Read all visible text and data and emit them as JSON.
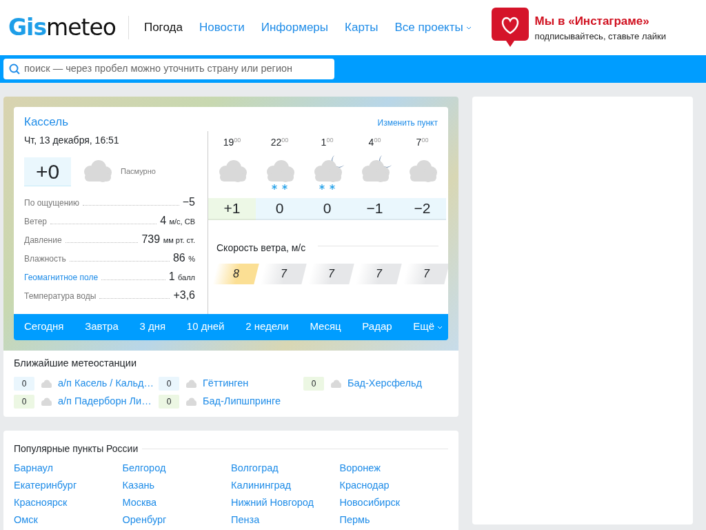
{
  "header": {
    "logo": {
      "accent": "Gis",
      "rest": "meteo"
    },
    "nav": [
      {
        "label": "Погода",
        "selected": true,
        "dropdown": false
      },
      {
        "label": "Новости",
        "selected": false,
        "dropdown": false
      },
      {
        "label": "Информеры",
        "selected": false,
        "dropdown": false
      },
      {
        "label": "Карты",
        "selected": false,
        "dropdown": false
      },
      {
        "label": "Все проекты",
        "selected": false,
        "dropdown": true
      }
    ],
    "promo": {
      "title": "Мы в «Инстаграме»",
      "subtitle": "подписывайтесь, ставьте лайки"
    }
  },
  "search": {
    "placeholder": "поиск — через пробел можно уточнить страну или регион"
  },
  "weather": {
    "city": "Кассель",
    "change_link": "Изменить пункт",
    "datetime": "Чт, 13 декабря, 16:51",
    "temperature": "+0",
    "condition": "Пасмурно",
    "details": [
      {
        "label": "По ощущению",
        "value": "−5",
        "kind": "text"
      },
      {
        "label": "Ветер",
        "value": "4",
        "unit": "м/с, СВ",
        "kind": "text"
      },
      {
        "label": "Давление",
        "value": "739",
        "unit": "мм рт. ст.",
        "kind": "text"
      },
      {
        "label": "Влажность",
        "value": "86",
        "unit": "%",
        "kind": "text"
      },
      {
        "label": "Геомагнитное поле",
        "value": "1",
        "unit": "балл",
        "kind": "link"
      },
      {
        "label": "Температура воды",
        "value": "+3,6",
        "kind": "text"
      }
    ],
    "hours": [
      {
        "hour": "19",
        "minutes": "00",
        "night": false,
        "snow": false,
        "temp": "+1",
        "color": "#edf8e6",
        "wind": "8",
        "gust": true
      },
      {
        "hour": "22",
        "minutes": "00",
        "night": false,
        "snow": true,
        "temp": "0",
        "color": "#eaf7fd",
        "wind": "7",
        "gust": false
      },
      {
        "hour": "1",
        "minutes": "00",
        "night": true,
        "snow": true,
        "temp": "0",
        "color": "#eaf7fd",
        "wind": "7",
        "gust": false
      },
      {
        "hour": "4",
        "minutes": "00",
        "night": true,
        "snow": false,
        "temp": "−1",
        "color": "#eaf7fd",
        "wind": "7",
        "gust": false
      },
      {
        "hour": "7",
        "minutes": "00",
        "night": false,
        "snow": false,
        "temp": "−2",
        "color": "#eaf7fd",
        "wind": "7",
        "gust": false
      }
    ],
    "wind_title": "Скорость ветра, м/с",
    "tabs": [
      {
        "label": "Сегодня",
        "dropdown": false
      },
      {
        "label": "Завтра",
        "dropdown": false
      },
      {
        "label": "3 дня",
        "dropdown": false
      },
      {
        "label": "10 дней",
        "dropdown": false
      },
      {
        "label": "2 недели",
        "dropdown": false
      },
      {
        "label": "Месяц",
        "dropdown": false
      },
      {
        "label": "Радар",
        "dropdown": false
      },
      {
        "label": "Ещё",
        "dropdown": true
      }
    ]
  },
  "stations": {
    "title": "Ближайшие метеостанции",
    "items": [
      {
        "temp": "0",
        "color": "#eaf6fd",
        "name": "а/п Касель / Кальд…"
      },
      {
        "temp": "0",
        "color": "#eaf6fd",
        "name": "Гёттинген"
      },
      {
        "temp": "0",
        "color": "#ecf7e3",
        "name": "Бад-Херсфельд"
      },
      {
        "temp": "0",
        "color": "#ecf7e3",
        "name": "а/п Падерборн Ли…"
      },
      {
        "temp": "0",
        "color": "#ecf7e3",
        "name": "Бад-Липшпринге"
      }
    ]
  },
  "popular": {
    "title": "Популярные пункты России",
    "cities": [
      "Барнаул",
      "Белгород",
      "Волгоград",
      "Воронеж",
      "Екатеринбург",
      "Казань",
      "Калининград",
      "Краснодар",
      "Красноярск",
      "Москва",
      "Нижний Новгород",
      "Новосибирск",
      "Омск",
      "Оренбург",
      "Пенза",
      "Пермь"
    ]
  }
}
